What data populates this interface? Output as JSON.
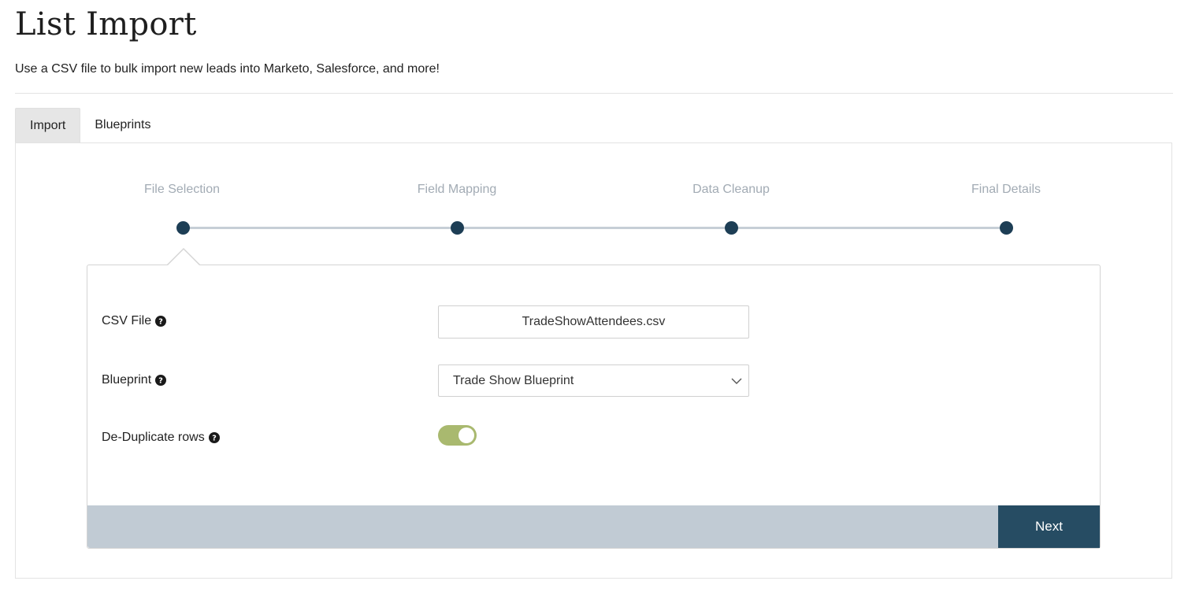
{
  "header": {
    "title": "List Import",
    "subtitle": "Use a CSV file to bulk import new leads into Marketo, Salesforce, and more!"
  },
  "tabs": [
    {
      "label": "Import",
      "active": true
    },
    {
      "label": "Blueprints",
      "active": false
    }
  ],
  "wizard": {
    "steps": [
      {
        "label": "File Selection",
        "current": true
      },
      {
        "label": "Field Mapping",
        "current": false
      },
      {
        "label": "Data Cleanup",
        "current": false
      },
      {
        "label": "Final Details",
        "current": false
      }
    ]
  },
  "form": {
    "csv_file": {
      "label": "CSV File",
      "value": "TradeShowAttendees.csv"
    },
    "blueprint": {
      "label": "Blueprint",
      "selected": "Trade Show Blueprint"
    },
    "dedupe": {
      "label": "De-Duplicate rows",
      "enabled": true
    }
  },
  "footer": {
    "next_label": "Next"
  },
  "colors": {
    "step_dot": "#1d3e55",
    "toggle_on": "#a9b96f",
    "footer_bar": "#c1cbd4",
    "next_button": "#264c63"
  },
  "icons": {
    "help": "question-circle-icon",
    "dropdown": "chevron-down-icon"
  }
}
